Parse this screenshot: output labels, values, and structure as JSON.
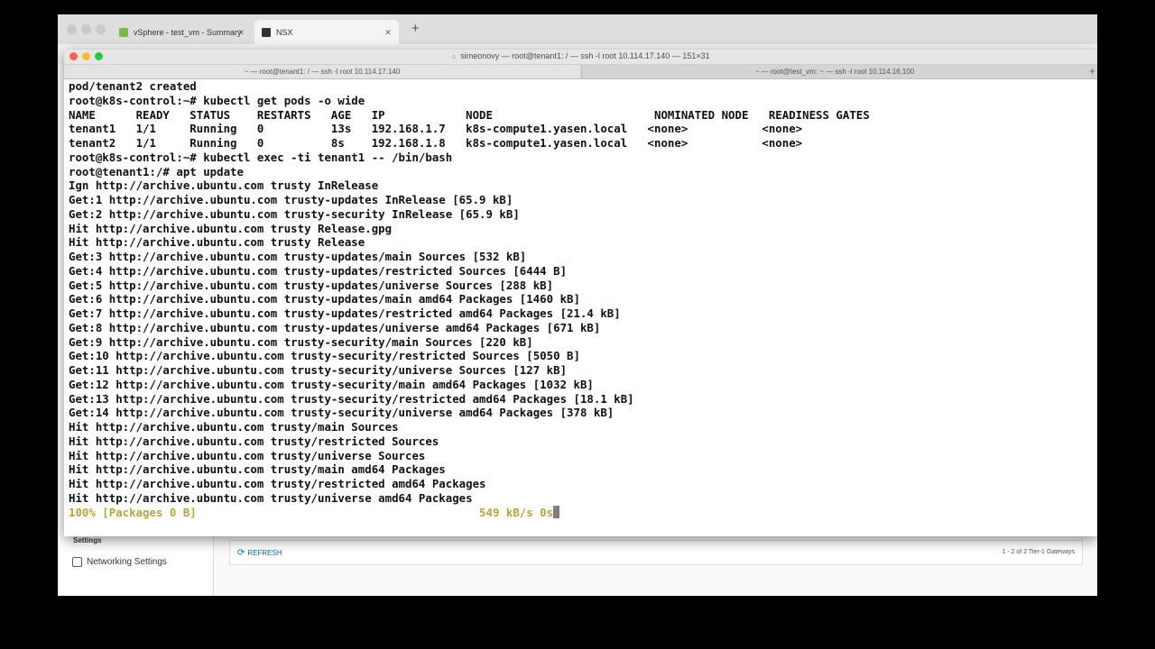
{
  "browser": {
    "tabs": [
      {
        "label": "vSphere - test_vm - Summary",
        "active": false
      },
      {
        "label": "NSX",
        "active": true
      }
    ],
    "new_tab_label": "+",
    "close_glyph": "✕"
  },
  "nsx": {
    "sidebar_section": "Settings",
    "sidebar_item": "Networking Settings",
    "refresh_label": "REFRESH",
    "gateway_count": "1 - 2 of 2 Tier-1 Gateways"
  },
  "terminal": {
    "title": "simeonovy — root@tenant1: / — ssh -l root 10.114.17.140 — 151×31",
    "tabs": [
      {
        "label": "~ — root@tenant1: / — ssh -l root 10.114.17.140",
        "active": true
      },
      {
        "label": "~ — root@test_vm: ~ — ssh -l root 10.114.16.100",
        "active": false
      }
    ],
    "new_tab_label": "+",
    "lines": [
      "pod/tenant2 created",
      "root@k8s-control:~# kubectl get pods -o wide",
      "NAME      READY   STATUS    RESTARTS   AGE   IP            NODE                        NOMINATED NODE   READINESS GATES",
      "tenant1   1/1     Running   0          13s   192.168.1.7   k8s-compute1.yasen.local   <none>           <none>",
      "tenant2   1/1     Running   0          8s    192.168.1.8   k8s-compute1.yasen.local   <none>           <none>",
      "root@k8s-control:~# kubectl exec -ti tenant1 -- /bin/bash",
      "root@tenant1:/# apt update",
      "Ign http://archive.ubuntu.com trusty InRelease",
      "Get:1 http://archive.ubuntu.com trusty-updates InRelease [65.9 kB]",
      "Get:2 http://archive.ubuntu.com trusty-security InRelease [65.9 kB]",
      "Hit http://archive.ubuntu.com trusty Release.gpg",
      "Hit http://archive.ubuntu.com trusty Release",
      "Get:3 http://archive.ubuntu.com trusty-updates/main Sources [532 kB]",
      "Get:4 http://archive.ubuntu.com trusty-updates/restricted Sources [6444 B]",
      "Get:5 http://archive.ubuntu.com trusty-updates/universe Sources [288 kB]",
      "Get:6 http://archive.ubuntu.com trusty-updates/main amd64 Packages [1460 kB]",
      "Get:7 http://archive.ubuntu.com trusty-updates/restricted amd64 Packages [21.4 kB]",
      "Get:8 http://archive.ubuntu.com trusty-updates/universe amd64 Packages [671 kB]",
      "Get:9 http://archive.ubuntu.com trusty-security/main Sources [220 kB]",
      "Get:10 http://archive.ubuntu.com trusty-security/restricted Sources [5050 B]",
      "Get:11 http://archive.ubuntu.com trusty-security/universe Sources [127 kB]",
      "Get:12 http://archive.ubuntu.com trusty-security/main amd64 Packages [1032 kB]",
      "Get:13 http://archive.ubuntu.com trusty-security/restricted amd64 Packages [18.1 kB]",
      "Get:14 http://archive.ubuntu.com trusty-security/universe amd64 Packages [378 kB]",
      "Hit http://archive.ubuntu.com trusty/main Sources",
      "Hit http://archive.ubuntu.com trusty/restricted Sources",
      "Hit http://archive.ubuntu.com trusty/universe Sources",
      "Hit http://archive.ubuntu.com trusty/main amd64 Packages",
      "Hit http://archive.ubuntu.com trusty/restricted amd64 Packages",
      "Hit http://archive.ubuntu.com trusty/universe amd64 Packages"
    ],
    "status_line": "100% [Packages 0 B]                                          549 kB/s 0s",
    "status_color": "#b5a53a"
  },
  "colors": {
    "traffic_close": "#fc5f57",
    "traffic_min": "#fdbc2e",
    "traffic_max": "#28c840",
    "link_blue": "#0072a3"
  }
}
